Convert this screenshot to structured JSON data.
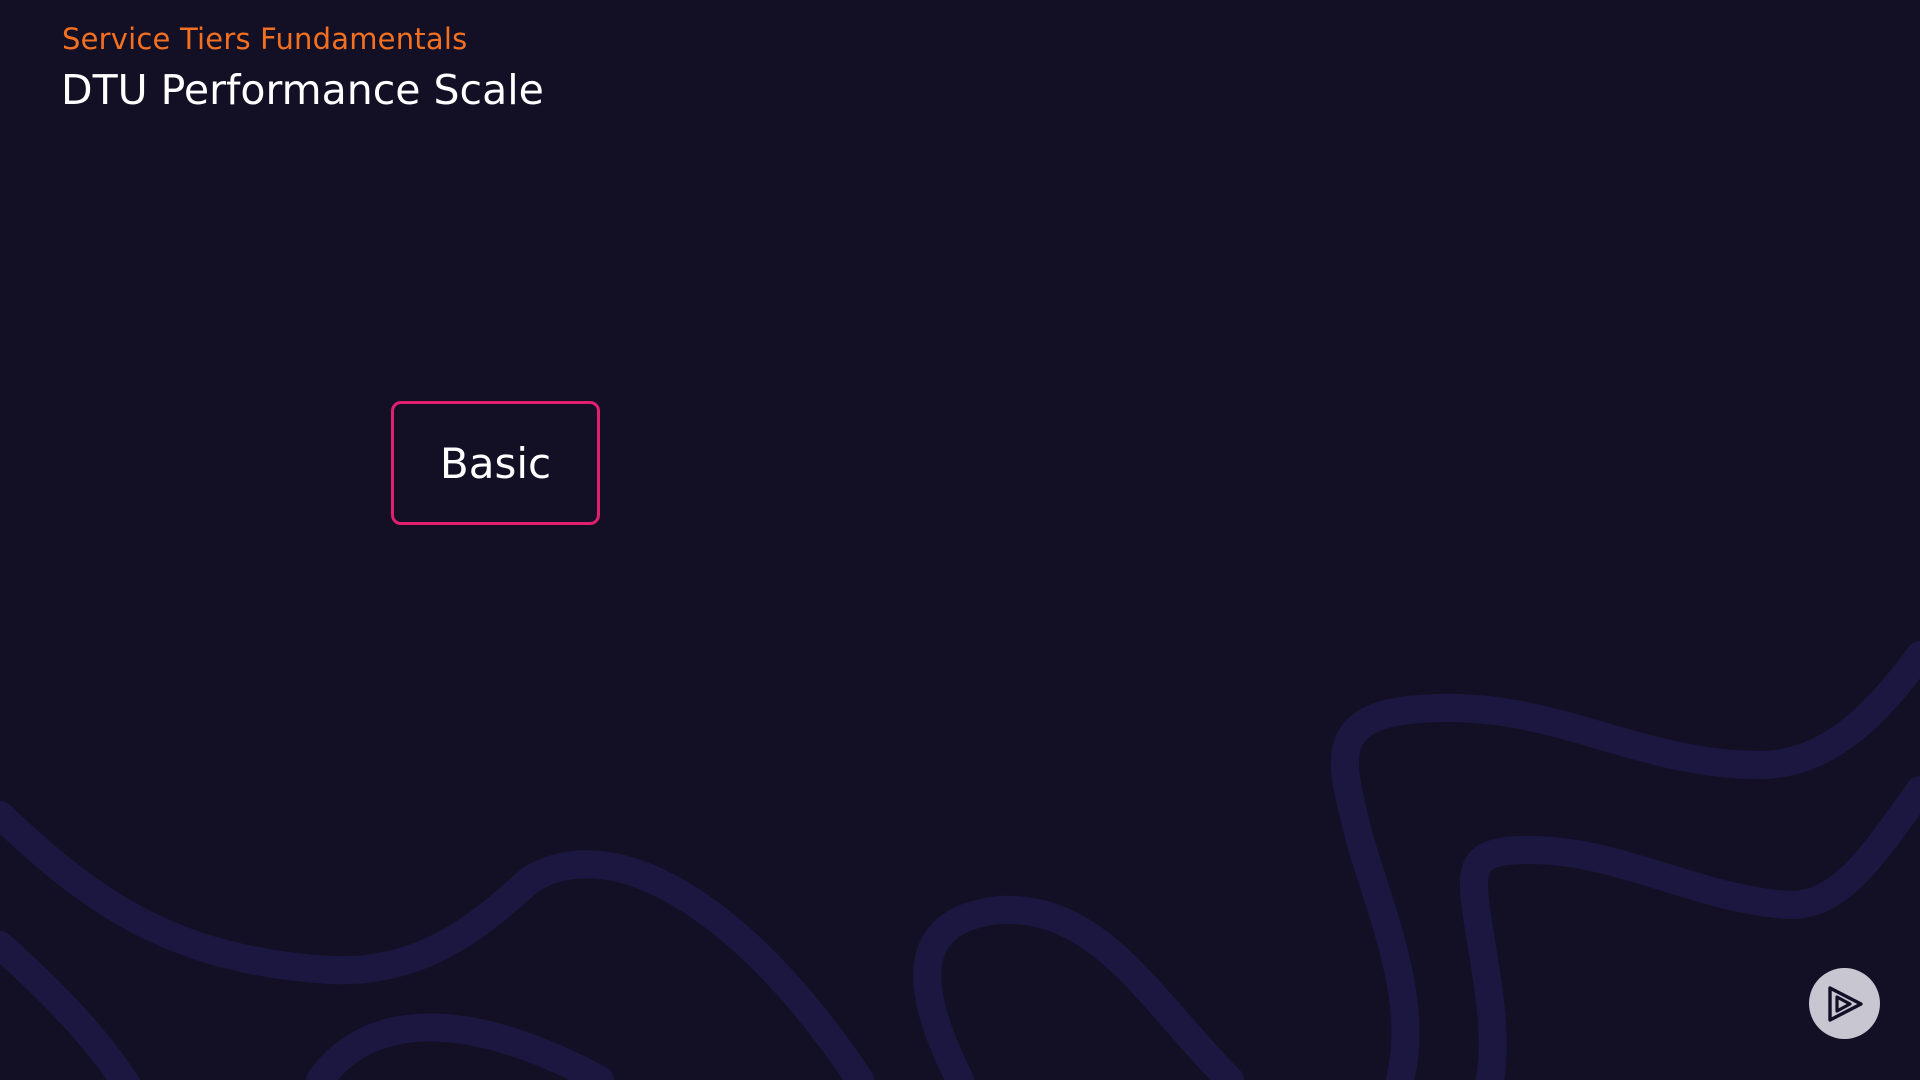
{
  "header": {
    "eyebrow": "Service Tiers Fundamentals",
    "title": "DTU Performance Scale"
  },
  "tier": {
    "label": "Basic"
  },
  "controls": {
    "play_icon": "play-logo-icon"
  },
  "colors": {
    "background": "#131026",
    "eyebrow": "#f37021",
    "title": "#ffffff",
    "tier_border": "#e0206e",
    "waves": "#1c1740",
    "play_button": "#c8c6d0"
  }
}
